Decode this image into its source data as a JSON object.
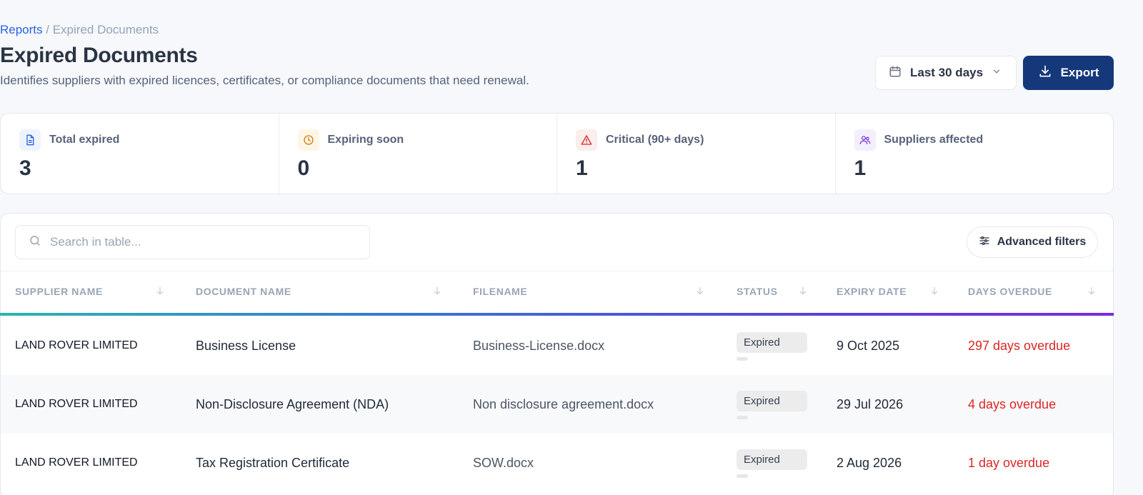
{
  "breadcrumb": {
    "parent": "Reports",
    "separator": " / ",
    "current": "Expired Documents"
  },
  "page": {
    "title": "Expired Documents",
    "subtitle": "Identifies suppliers with expired licences, certificates, or compliance documents that need renewal."
  },
  "toolbar": {
    "date_range": "Last 30 days",
    "export_label": "Export"
  },
  "stats": [
    {
      "label": "Total expired",
      "value": "3",
      "icon": "document-icon",
      "color": "#2563eb"
    },
    {
      "label": "Expiring soon",
      "value": "0",
      "icon": "clock-icon",
      "color": "#d97706"
    },
    {
      "label": "Critical (90+ days)",
      "value": "1",
      "icon": "alert-triangle-icon",
      "color": "#dc2626"
    },
    {
      "label": "Suppliers affected",
      "value": "1",
      "icon": "users-icon",
      "color": "#7c3aed"
    }
  ],
  "table": {
    "search_placeholder": "Search in table...",
    "advanced_filters_label": "Advanced filters",
    "columns": [
      "SUPPLIER NAME",
      "DOCUMENT NAME",
      "FILENAME",
      "STATUS",
      "EXPIRY DATE",
      "DAYS OVERDUE"
    ],
    "rows": [
      {
        "supplier": "LAND ROVER LIMITED",
        "document": "Business License",
        "filename": "Business-License.docx",
        "status": "Expired",
        "expiry": "9 Oct 2025",
        "overdue": "297 days overdue"
      },
      {
        "supplier": "LAND ROVER LIMITED",
        "document": "Non-Disclosure Agreement (NDA)",
        "filename": "Non disclosure agreement.docx",
        "status": "Expired",
        "expiry": "29 Jul 2026",
        "overdue": "4 days overdue"
      },
      {
        "supplier": "LAND ROVER LIMITED",
        "document": "Tax Registration Certificate",
        "filename": "SOW.docx",
        "status": "Expired",
        "expiry": "2 Aug 2026",
        "overdue": "1 day overdue"
      }
    ]
  },
  "colors": {
    "primary": "#14387a",
    "link": "#2563eb",
    "overdue": "#dc2626"
  }
}
